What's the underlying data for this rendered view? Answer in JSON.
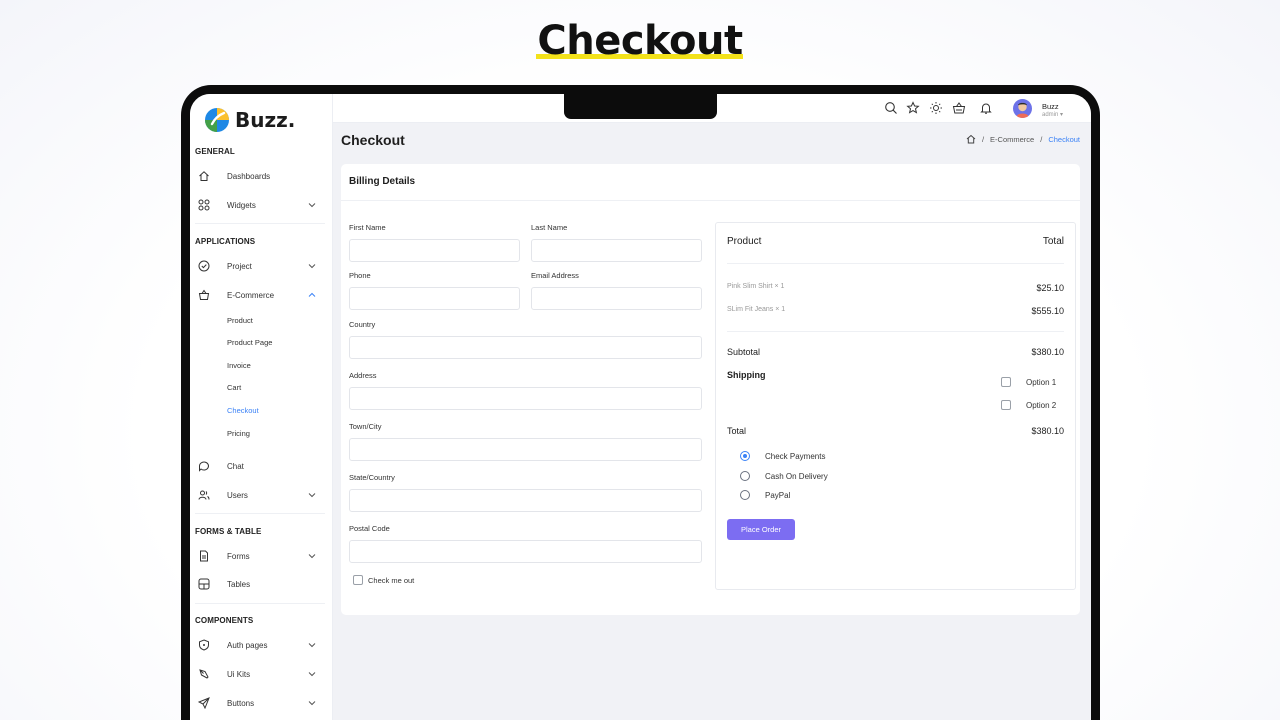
{
  "banner": {
    "title": "Checkout"
  },
  "app": {
    "brand": "Buzz."
  },
  "sidebar": {
    "sections": {
      "general": "GENERAL",
      "applications": "APPLICATIONS",
      "forms_table": "FORMS & TABLE",
      "components": "COMPONENTS"
    },
    "items": {
      "dashboards": "Dashboards",
      "widgets": "Widgets",
      "project": "Project",
      "ecommerce": "E-Commerce",
      "chat": "Chat",
      "users": "Users",
      "forms": "Forms",
      "tables": "Tables",
      "auth_pages": "Auth pages",
      "ui_kits": "Ui Kits",
      "buttons": "Buttons"
    },
    "ecommerce_sub": {
      "product": "Product",
      "product_page": "Product Page",
      "invoice": "Invoice",
      "cart": "Cart",
      "checkout": "Checkout",
      "pricing": "Pricing"
    },
    "active_sub": "Checkout"
  },
  "topbar": {
    "icons": [
      "search-icon",
      "star-icon",
      "sun-icon",
      "basket-icon",
      "bell-icon"
    ],
    "user_name": "Buzz",
    "user_role": "admin"
  },
  "page": {
    "title": "Checkout",
    "breadcrumb": {
      "section": "E-Commerce",
      "current": "Checkout"
    }
  },
  "billing": {
    "title": "Billing Details",
    "fields": {
      "first_name": {
        "label": "First Name",
        "value": ""
      },
      "last_name": {
        "label": "Last Name",
        "value": ""
      },
      "phone": {
        "label": "Phone",
        "value": ""
      },
      "email": {
        "label": "Email Address",
        "value": ""
      },
      "country": {
        "label": "Country",
        "value": ""
      },
      "address": {
        "label": "Address",
        "value": ""
      },
      "town": {
        "label": "Town/City",
        "value": ""
      },
      "state": {
        "label": "State/Country",
        "value": ""
      },
      "postal": {
        "label": "Postal Code",
        "value": ""
      }
    },
    "check_me_out": "Check me out",
    "check_me_out_checked": false
  },
  "order": {
    "product_header": "Product",
    "total_header": "Total",
    "items": [
      {
        "name": "Pink Slim Shirt × 1",
        "price": "$25.10"
      },
      {
        "name": "SLim Fit Jeans × 1",
        "price": "$555.10"
      }
    ],
    "subtotal_label": "Subtotal",
    "subtotal_value": "$380.10",
    "shipping_label": "Shipping",
    "shipping_options": [
      "Option 1",
      "Option 2"
    ],
    "total_label": "Total",
    "total_value": "$380.10",
    "payment_methods": [
      "Check Payments",
      "Cash On Delivery",
      "PayPal"
    ],
    "selected_payment": "Check Payments",
    "place_order": "Place Order"
  },
  "colors": {
    "accent": "#3b82f6",
    "button": "#7c6df2",
    "highlight": "#f3e21a"
  }
}
